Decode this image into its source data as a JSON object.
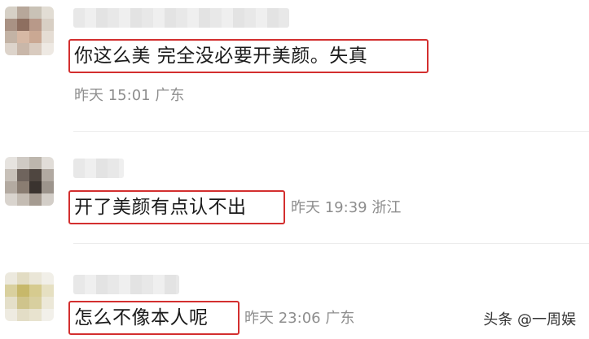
{
  "comments": [
    {
      "text": "你这么美 完全没必要开美颜。失真",
      "meta": "昨天 15:01 广东"
    },
    {
      "text": "开了美颜有点认不出",
      "meta": "昨天 19:39 浙江"
    },
    {
      "text": "怎么不像本人呢",
      "meta": "昨天 23:06 广东"
    }
  ],
  "watermark": "头条 @一周娱",
  "colors": {
    "highlight": "#d32f2f",
    "meta": "#8e8e8e",
    "text": "#1a1a1a"
  }
}
